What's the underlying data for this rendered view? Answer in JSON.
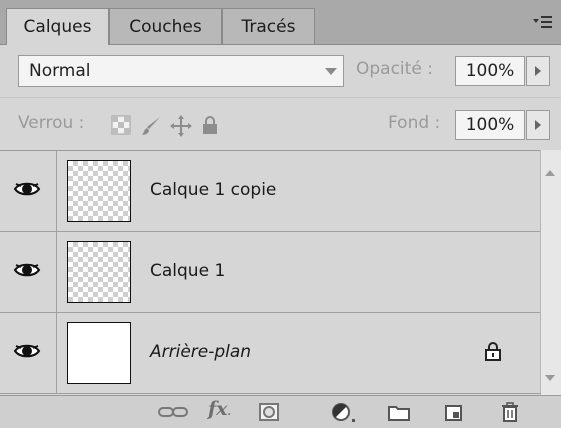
{
  "tabs": [
    {
      "label": "Calques",
      "active": true
    },
    {
      "label": "Couches",
      "active": false
    },
    {
      "label": "Tracés",
      "active": false
    }
  ],
  "panel_menu_icon": "panel-menu-icon",
  "blend": {
    "mode": "Normal",
    "opacity_label": "Opacité :",
    "opacity_value": "100%"
  },
  "lock": {
    "label": "Verrou :",
    "icons": [
      "lock-transparent-pixels-icon",
      "lock-image-pixels-icon",
      "lock-position-icon",
      "lock-all-icon"
    ],
    "fill_label": "Fond :",
    "fill_value": "100%"
  },
  "layers": [
    {
      "name": "Calque 1 copie",
      "visible": true,
      "thumbnail": "transparent",
      "locked": false,
      "italic": false
    },
    {
      "name": "Calque 1",
      "visible": true,
      "thumbnail": "transparent",
      "locked": false,
      "italic": false
    },
    {
      "name": "Arrière-plan",
      "visible": true,
      "thumbnail": "white",
      "locked": true,
      "italic": true
    }
  ],
  "toolbar_icons": [
    "link-layers-icon",
    "fx-icon",
    "layer-mask-icon",
    "adjustment-layer-icon",
    "new-group-icon",
    "new-layer-icon",
    "delete-layer-icon"
  ],
  "colors": {
    "panel_bg": "#d6d6d6",
    "tab_bar_bg": "#a9a9a9",
    "field_bg": "#f4f4f4"
  }
}
